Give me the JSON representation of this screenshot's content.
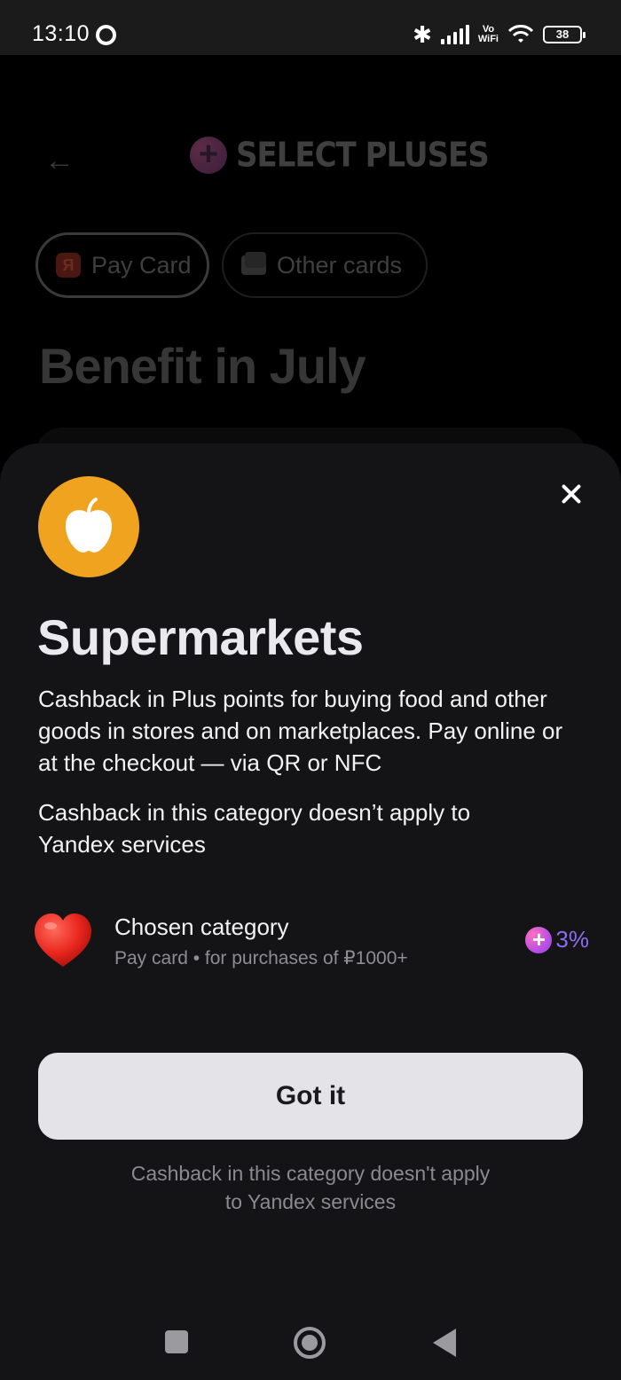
{
  "status_bar": {
    "time": "13:10",
    "vowifi_top": "Vo",
    "vowifi_bottom": "WiFi",
    "battery": "38"
  },
  "background": {
    "logo_text": "SELECT PLUSES",
    "chips": [
      {
        "label": "Pay Card",
        "badge": "Я"
      },
      {
        "label": "Other cards"
      }
    ],
    "title": "Benefit in July"
  },
  "sheet": {
    "title": "Supermarkets",
    "description": "Cashback in Plus points for buying food and other goods in stores and on marketplaces. Pay online or at the checkout — via QR or NFC",
    "note": "Cashback in this category doesn’t apply to Yandex services",
    "chosen": {
      "title": "Chosen category",
      "subtitle": "Pay card • for purchases of ₽1000+",
      "cashback": "3%"
    },
    "button_label": "Got it",
    "footnote_line1": "Cashback in this category doesn't apply",
    "footnote_line2": "to Yandex services"
  },
  "colors": {
    "sheet_bg": "#141416",
    "category_icon_bg": "#f0a31e",
    "cashback_accent": "#8c6cf2",
    "button_bg": "#e4e4e8"
  },
  "icons": {
    "category": "apple-icon",
    "chosen": "heart-icon",
    "close": "close-icon",
    "plus": "plus-badge-icon"
  }
}
